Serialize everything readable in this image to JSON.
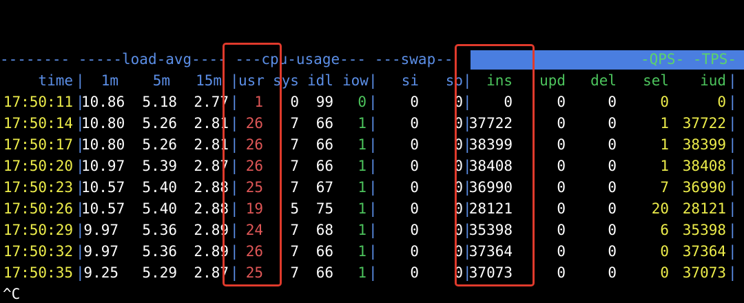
{
  "group_header": {
    "prefix": "-------- -----",
    "load_avg": "load-avg",
    "load_tail": "---- ---",
    "cpu_usage": "cpu-usage",
    "cpu_tail": "--- ---",
    "swap": "swap",
    "swap_tail": "--",
    "qps_tps": "-QPS- -TPS-"
  },
  "columns": {
    "time": "time",
    "m1": "1m",
    "m5": "5m",
    "m15": "15m",
    "usr": "usr",
    "sys": "sys",
    "idl": "idl",
    "iow": "iow",
    "si": "si",
    "so": "so",
    "ins": "ins",
    "upd": "upd",
    "del": "del",
    "sel": "sel",
    "iud": "iud"
  },
  "rows": [
    {
      "time": "17:50:11",
      "m1": "10.86",
      "m5": "5.18",
      "m15": "2.77",
      "usr": "1",
      "sys": "0",
      "idl": "99",
      "iow": "0",
      "si": "0",
      "so": "0",
      "ins": "0",
      "upd": "0",
      "del": "0",
      "sel": "0",
      "iud": "0"
    },
    {
      "time": "17:50:14",
      "m1": "10.80",
      "m5": "5.26",
      "m15": "2.81",
      "usr": "26",
      "sys": "7",
      "idl": "66",
      "iow": "1",
      "si": "0",
      "so": "0",
      "ins": "37722",
      "upd": "0",
      "del": "0",
      "sel": "1",
      "iud": "37722"
    },
    {
      "time": "17:50:17",
      "m1": "10.80",
      "m5": "5.26",
      "m15": "2.81",
      "usr": "26",
      "sys": "7",
      "idl": "66",
      "iow": "1",
      "si": "0",
      "so": "0",
      "ins": "38399",
      "upd": "0",
      "del": "0",
      "sel": "1",
      "iud": "38399"
    },
    {
      "time": "17:50:20",
      "m1": "10.97",
      "m5": "5.39",
      "m15": "2.87",
      "usr": "26",
      "sys": "7",
      "idl": "66",
      "iow": "1",
      "si": "0",
      "so": "0",
      "ins": "38408",
      "upd": "0",
      "del": "0",
      "sel": "1",
      "iud": "38408"
    },
    {
      "time": "17:50:23",
      "m1": "10.57",
      "m5": "5.40",
      "m15": "2.88",
      "usr": "25",
      "sys": "7",
      "idl": "67",
      "iow": "1",
      "si": "0",
      "so": "0",
      "ins": "36990",
      "upd": "0",
      "del": "0",
      "sel": "7",
      "iud": "36990"
    },
    {
      "time": "17:50:26",
      "m1": "10.57",
      "m5": "5.40",
      "m15": "2.88",
      "usr": "19",
      "sys": "5",
      "idl": "75",
      "iow": "1",
      "si": "0",
      "so": "0",
      "ins": "28121",
      "upd": "0",
      "del": "0",
      "sel": "20",
      "iud": "28121"
    },
    {
      "time": "17:50:29",
      "m1": "9.97",
      "m5": "5.36",
      "m15": "2.89",
      "usr": "24",
      "sys": "7",
      "idl": "68",
      "iow": "1",
      "si": "0",
      "so": "0",
      "ins": "35398",
      "upd": "0",
      "del": "0",
      "sel": "6",
      "iud": "35398"
    },
    {
      "time": "17:50:32",
      "m1": "9.97",
      "m5": "5.36",
      "m15": "2.89",
      "usr": "26",
      "sys": "7",
      "idl": "66",
      "iow": "1",
      "si": "0",
      "so": "0",
      "ins": "37364",
      "upd": "0",
      "del": "0",
      "sel": "0",
      "iud": "37364"
    },
    {
      "time": "17:50:35",
      "m1": "9.25",
      "m5": "5.29",
      "m15": "2.87",
      "usr": "25",
      "sys": "7",
      "idl": "66",
      "iow": "1",
      "si": "0",
      "so": "0",
      "ins": "37073",
      "upd": "0",
      "del": "0",
      "sel": "0",
      "iud": "37073"
    }
  ],
  "interrupt": "^C",
  "colors": {
    "background": "#000000",
    "header_blue": "#5b8ee6",
    "highlight_bar": "#4a7ee0",
    "time_yellow": "#eded4a",
    "usr_red": "#e05757",
    "iow_green": "#4cc35c",
    "annotation_box": "#e03a2c"
  }
}
